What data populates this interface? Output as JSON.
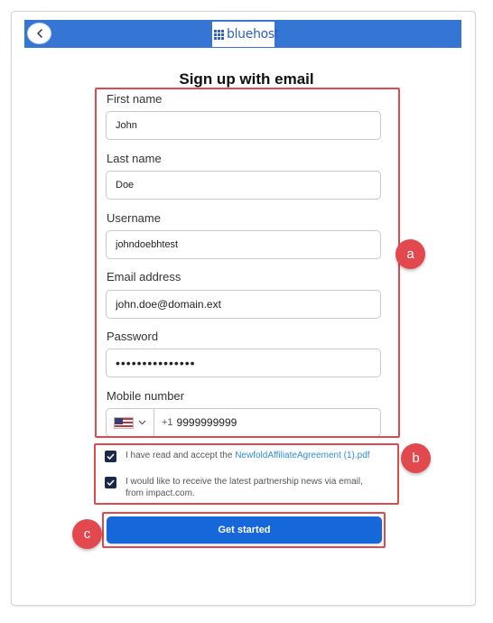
{
  "header": {
    "logo_text": "bluehost",
    "back_icon": "chevron-left-icon",
    "bar_color": "#3575d3"
  },
  "form": {
    "title": "Sign up with email",
    "fields": {
      "first_name": {
        "label": "First name",
        "value": "John"
      },
      "last_name": {
        "label": "Last name",
        "value": "Doe"
      },
      "username": {
        "label": "Username",
        "value": "johndoebhtest"
      },
      "email": {
        "label": "Email address",
        "value": "john.doe@domain.ext"
      },
      "password": {
        "label": "Password",
        "value": "•••••••••••••••"
      },
      "mobile": {
        "label": "Mobile number",
        "country_icon": "us-flag-icon",
        "dial_code": "+1",
        "value": "9999999999"
      }
    },
    "agreement": {
      "text": "I have read and accept the ",
      "link": "NewfoldAffiliateAgreement (1).pdf",
      "checked": true
    },
    "newsletter": {
      "text": "I would like to receive the latest partnership news via email, from impact.com.",
      "checked": true
    },
    "submit_label": "Get started",
    "submit_color": "#1667d9"
  },
  "annotations": {
    "color": "#e2494f",
    "markers": [
      "a",
      "b",
      "c"
    ]
  }
}
